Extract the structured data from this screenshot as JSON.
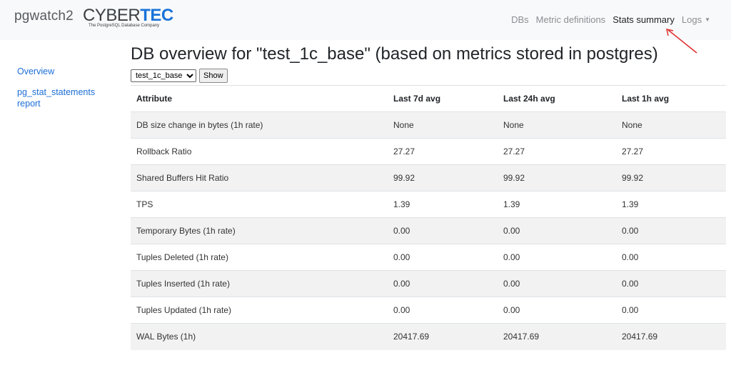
{
  "navbar": {
    "brand": "pgwatch2",
    "logo": {
      "part1": "CYBER",
      "part2": "TEC",
      "tagline": "The PostgreSQL Database Company"
    },
    "links": [
      {
        "label": "DBs",
        "active": false
      },
      {
        "label": "Metric definitions",
        "active": false
      },
      {
        "label": "Stats summary",
        "active": true
      },
      {
        "label": "Logs",
        "active": false,
        "dropdown": true
      }
    ]
  },
  "sidebar": {
    "items": [
      {
        "label": "Overview"
      },
      {
        "label": "pg_stat_statements report"
      }
    ]
  },
  "main": {
    "title": "DB overview for \"test_1c_base\" (based on metrics stored in postgres)",
    "db_select": {
      "selected": "test_1c_base"
    },
    "show_label": "Show",
    "table": {
      "headers": [
        "Attribute",
        "Last 7d avg",
        "Last 24h avg",
        "Last 1h avg"
      ],
      "rows": [
        [
          "DB size change in bytes (1h rate)",
          "None",
          "None",
          "None"
        ],
        [
          "Rollback Ratio",
          "27.27",
          "27.27",
          "27.27"
        ],
        [
          "Shared Buffers Hit Ratio",
          "99.92",
          "99.92",
          "99.92"
        ],
        [
          "TPS",
          "1.39",
          "1.39",
          "1.39"
        ],
        [
          "Temporary Bytes (1h rate)",
          "0.00",
          "0.00",
          "0.00"
        ],
        [
          "Tuples Deleted (1h rate)",
          "0.00",
          "0.00",
          "0.00"
        ],
        [
          "Tuples Inserted (1h rate)",
          "0.00",
          "0.00",
          "0.00"
        ],
        [
          "Tuples Updated (1h rate)",
          "0.00",
          "0.00",
          "0.00"
        ],
        [
          "WAL Bytes (1h)",
          "20417.69",
          "20417.69",
          "20417.69"
        ]
      ]
    }
  },
  "colors": {
    "navbar_bg": "#f8f9fa",
    "link_blue": "#1c6ed6",
    "logo_blue": "#1a73d9",
    "annotation_arrow": "#e03030",
    "row_stripe": "#f2f2f2"
  },
  "icons": {
    "logs_dropdown": "caret-down-icon",
    "annotation": "arrow-annotation"
  }
}
